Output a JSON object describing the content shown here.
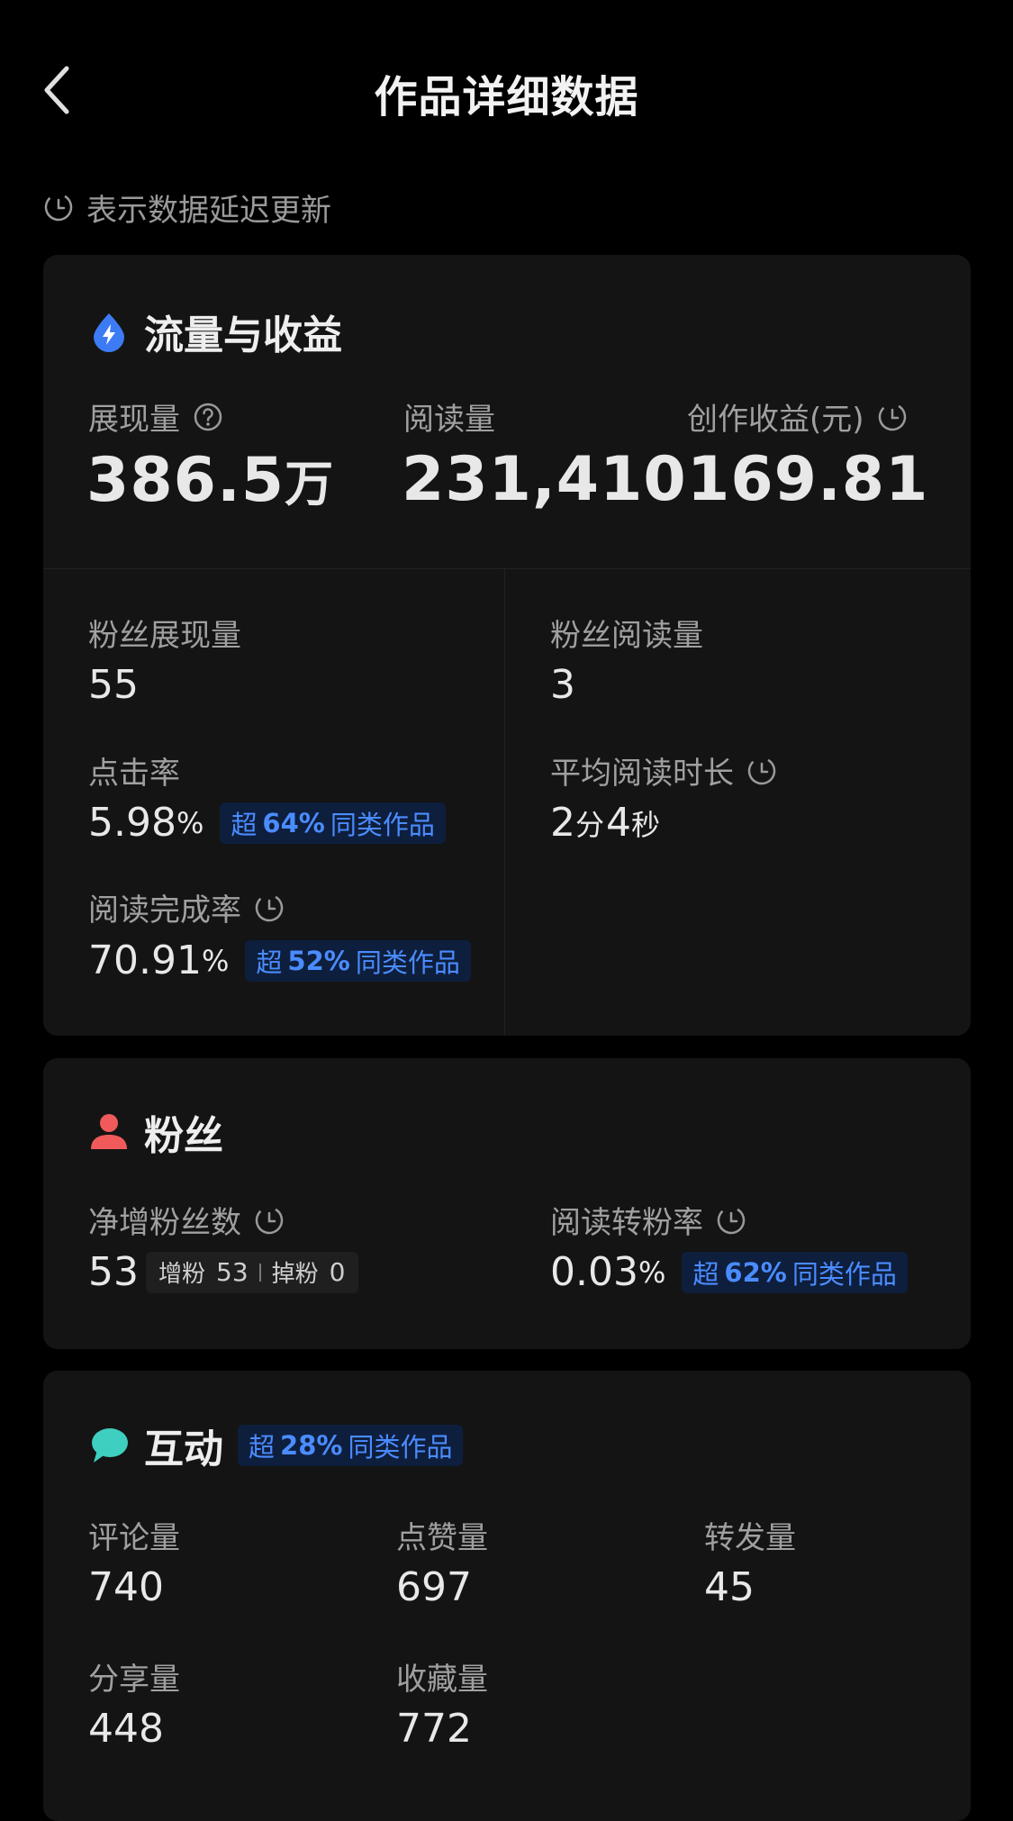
{
  "header": {
    "title": "作品详细数据"
  },
  "note": {
    "text": "表示数据延迟更新"
  },
  "traffic": {
    "title": "流量与收益",
    "impressions": {
      "label": "展现量",
      "value": "386.5",
      "unit": "万"
    },
    "reads": {
      "label": "阅读量",
      "value": "231,410"
    },
    "revenue": {
      "label": "创作收益(元)",
      "value": "169.81"
    },
    "fan_impressions": {
      "label": "粉丝展现量",
      "value": "55"
    },
    "fan_reads": {
      "label": "粉丝阅读量",
      "value": "3"
    },
    "ctr": {
      "label": "点击率",
      "value": "5.98",
      "unit": "%",
      "badge_prefix": "超",
      "badge_value": "64%",
      "badge_suffix": "同类作品"
    },
    "avg_read_time": {
      "label": "平均阅读时长",
      "minutes": "2",
      "minutes_unit": "分",
      "seconds": "4",
      "seconds_unit": "秒"
    },
    "completion": {
      "label": "阅读完成率",
      "value": "70.91",
      "unit": "%",
      "badge_prefix": "超",
      "badge_value": "52%",
      "badge_suffix": "同类作品"
    }
  },
  "fans": {
    "title": "粉丝",
    "net_gain": {
      "label": "净增粉丝数",
      "value": "53",
      "gain_label": "增粉",
      "gain_value": "53",
      "loss_label": "掉粉",
      "loss_value": "0"
    },
    "conversion": {
      "label": "阅读转粉率",
      "value": "0.03",
      "unit": "%",
      "badge_prefix": "超",
      "badge_value": "62%",
      "badge_suffix": "同类作品"
    }
  },
  "interaction": {
    "title": "互动",
    "badge_prefix": "超",
    "badge_value": "28%",
    "badge_suffix": "同类作品",
    "metrics": [
      {
        "label": "评论量",
        "value": "740"
      },
      {
        "label": "点赞量",
        "value": "697"
      },
      {
        "label": "转发量",
        "value": "45"
      },
      {
        "label": "分享量",
        "value": "448"
      },
      {
        "label": "收藏量",
        "value": "772"
      }
    ]
  },
  "colors": {
    "background": "#000000",
    "card": "#141414",
    "badge_bg": "#0e1e3d",
    "badge_text": "#4a8cff",
    "traffic_icon": "#3d7bf5",
    "fans_icon": "#f05a5a",
    "interaction_icon": "#3ecfc0"
  },
  "icons": {
    "back": "chevron-left-icon",
    "delay": "clock-icon",
    "traffic": "water-drop-bolt-icon",
    "fans": "person-icon",
    "interaction": "chat-bubble-icon",
    "help": "question-circle-icon"
  }
}
